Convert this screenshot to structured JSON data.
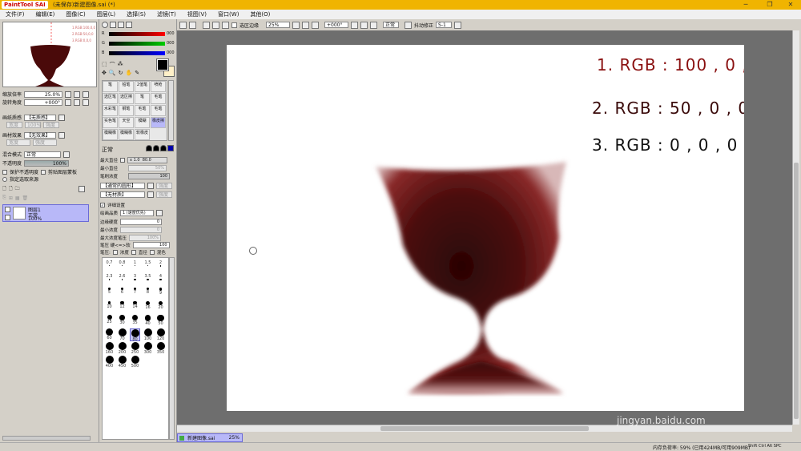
{
  "window": {
    "logo": "PaintTool SAI",
    "title": "(未保存)新建图像.sai (*)",
    "minimize": "─",
    "restore": "❐",
    "close": "✕"
  },
  "menu": [
    "文件(F)",
    "编辑(E)",
    "图像(C)",
    "图层(L)",
    "选择(S)",
    "滤镜(T)",
    "视图(V)",
    "窗口(W)",
    "其他(O)"
  ],
  "navigator": {
    "zoom_label": "缩放倍率",
    "zoom_value": "25.0%",
    "rotate_label": "旋转角度",
    "rotate_value": "+000°",
    "mini_lines": [
      "1.RGB:100,0,0",
      "2.RGB:50,0,0",
      "3.RGB:0,0,0"
    ]
  },
  "paper": {
    "texture_label": "画纸质感",
    "texture_value": "【无质感】",
    "strength_label": "强度",
    "strength_value": "100%",
    "effect_label": "画材效果",
    "effect_value": "【无效果】",
    "width_label": "宽度",
    "scale_label": "强度"
  },
  "layer_props": {
    "blend_label": "混合模式",
    "blend_value": "正常",
    "opacity_label": "不透明度",
    "opacity_value": "100%",
    "protect": "保护不透明度",
    "clip": "剪贴图层蒙板",
    "source": "指定选取来源"
  },
  "layer": {
    "name": "图层1",
    "mode": "正常",
    "opacity": "100%"
  },
  "colors": {
    "labels": [
      "R",
      "G",
      "B"
    ],
    "values": [
      "000",
      "000",
      "000"
    ]
  },
  "tools": [
    "笔",
    "铅笔",
    "2值笔",
    "喷枪",
    "选区笔",
    "选区擦",
    "笔",
    "毛笔",
    "水彩笔",
    "钢笔",
    "毛笔",
    "毛笔",
    "实色笔",
    "天空",
    "模糊",
    "橡皮擦",
    "模糊橡",
    "模糊橡",
    "软橡皮"
  ],
  "brush": {
    "mode_value": "正常",
    "max_label": "最大直径",
    "max_mult": "x 1.0",
    "max_value": "80.0",
    "min_label": "最小直径",
    "min_value": "50%",
    "density_label": "笔刷浓度",
    "density_value": "100",
    "shape_value": "【通常的圆形】",
    "shape_strength": "强度",
    "texture_value": "【无材质】",
    "texture_strength": "强度",
    "detail": "详细设置",
    "quality_label": "绘画品质",
    "quality_value": "1 (速度优先)",
    "edge_label": "边缘硬度",
    "edge_value": "0",
    "min_dens_label": "最小浓度",
    "min_dens_value": "0",
    "pressure_max_label": "最大浓度笔压",
    "pressure_max_value": "100%",
    "pressure_label": "笔压 硬<=>软",
    "pressure_value": "100",
    "pressure_opts": "笔压:",
    "dens_opt": "浓度",
    "dia_opt": "直径",
    "blend_opt": "混色"
  },
  "sizes": [
    "0.7",
    "0.8",
    "1",
    "1.5",
    "2",
    "2.3",
    "2.6",
    "3",
    "3.5",
    "4",
    "5",
    "6",
    "7",
    "8",
    "9",
    "10",
    "12",
    "14",
    "16",
    "20",
    "25",
    "30",
    "35",
    "40",
    "50",
    "60",
    "70",
    "80",
    "100",
    "120",
    "160",
    "200",
    "250",
    "300",
    "350",
    "400",
    "450",
    "500"
  ],
  "canvas_toolbar": {
    "selection_edge": "选区边缘",
    "zoom": "25%",
    "rotation": "+000°",
    "mode": "正常",
    "stabilizer_label": "抖动修正",
    "stabilizer_value": "S-1"
  },
  "canvas_text": [
    "1. RGB : 100 , 0 , 0",
    "2. RGB : 50 , 0 , 0",
    "3. RGB : 0 , 0 , 0"
  ],
  "tab": {
    "name": "新建图像.sai",
    "zoom": "25%"
  },
  "status": {
    "memory": "内存负荷率: 59% (已用424MB/可用909MB)",
    "keys": "Shift Ctrl Alt SPC",
    "watermark": "Bai 经验",
    "watermark_url": "jingyan.baidu.com"
  }
}
